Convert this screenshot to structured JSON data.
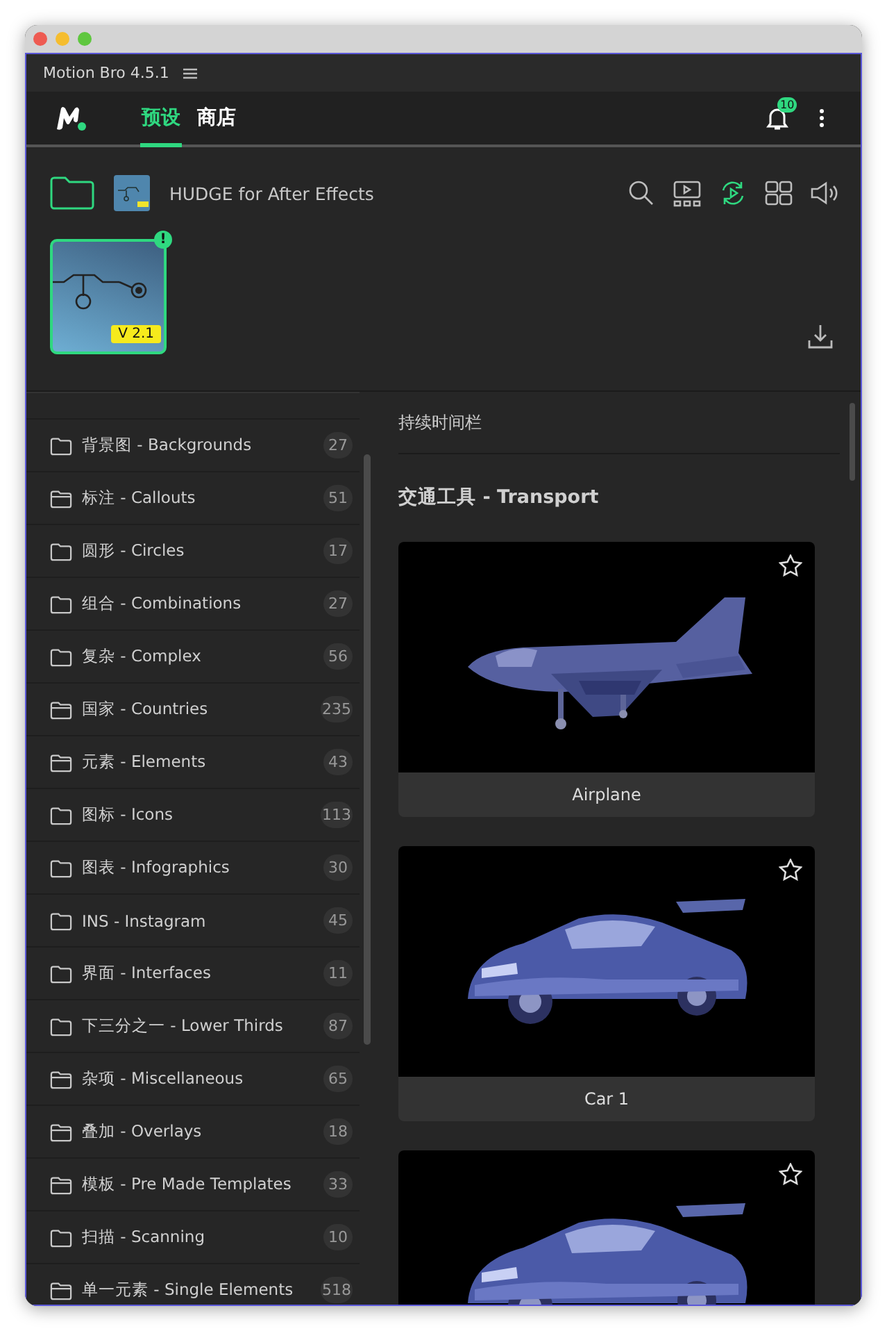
{
  "window": {
    "title": "Motion Bro 4.5.1"
  },
  "nav": {
    "tabs": [
      {
        "label": "预设",
        "selected": true
      },
      {
        "label": "商店",
        "selected": false
      }
    ],
    "notifications": "10"
  },
  "pack": {
    "title": "HUDGE for After Effects",
    "version": "V 2.1",
    "alert": "!",
    "toolbar": [
      {
        "kind": "search",
        "on": false
      },
      {
        "kind": "playlist",
        "on": false
      },
      {
        "kind": "autoplay",
        "on": true
      },
      {
        "kind": "grid",
        "on": false
      },
      {
        "kind": "sound",
        "on": false
      }
    ]
  },
  "sidebar": {
    "items": [
      {
        "label": "背景图 - Backgrounds",
        "count": "27",
        "kind": "plain"
      },
      {
        "label": "标注 - Callouts",
        "count": "51",
        "kind": "tabbed"
      },
      {
        "label": "圆形 - Circles",
        "count": "17",
        "kind": "plain"
      },
      {
        "label": "组合 - Combinations",
        "count": "27",
        "kind": "plain"
      },
      {
        "label": "复杂 - Complex",
        "count": "56",
        "kind": "plain"
      },
      {
        "label": "国家 - Countries",
        "count": "235",
        "kind": "tabbed"
      },
      {
        "label": "元素 - Elements",
        "count": "43",
        "kind": "tabbed"
      },
      {
        "label": "图标 - Icons",
        "count": "113",
        "kind": "plain"
      },
      {
        "label": "图表 - Infographics",
        "count": "30",
        "kind": "plain"
      },
      {
        "label": "INS - Instagram",
        "count": "45",
        "kind": "plain"
      },
      {
        "label": "界面 - Interfaces",
        "count": "11",
        "kind": "plain"
      },
      {
        "label": "下三分之一 - Lower Thirds",
        "count": "87",
        "kind": "plain"
      },
      {
        "label": "杂项 - Miscellaneous",
        "count": "65",
        "kind": "tabbed"
      },
      {
        "label": "叠加 - Overlays",
        "count": "18",
        "kind": "tabbed"
      },
      {
        "label": "模板 - Pre Made Templates",
        "count": "33",
        "kind": "tabbed"
      },
      {
        "label": "扫描 - Scanning",
        "count": "10",
        "kind": "plain"
      },
      {
        "label": "单一元素 - Single Elements",
        "count": "518",
        "kind": "tabbed"
      }
    ]
  },
  "content": {
    "previous_section": "持续时间栏",
    "section": "交通工具 - Transport",
    "cards": [
      {
        "title": "Airplane",
        "favorite": false,
        "kind": "plane"
      },
      {
        "title": "Car 1",
        "favorite": false,
        "kind": "car"
      },
      {
        "favorite": false,
        "kind": "car"
      }
    ]
  }
}
